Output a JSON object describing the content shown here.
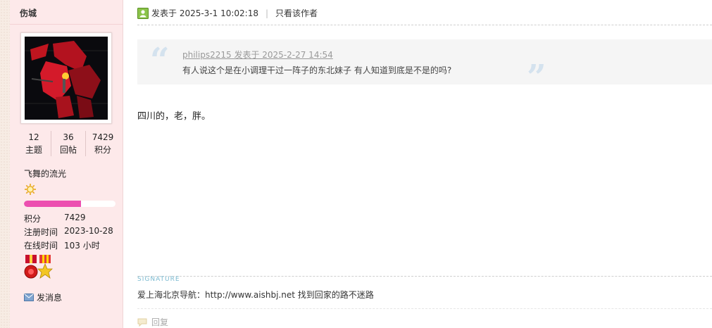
{
  "author": {
    "username": "伤城",
    "stats": [
      {
        "value": "12",
        "label": "主题"
      },
      {
        "value": "36",
        "label": "回帖"
      },
      {
        "value": "7429",
        "label": "积分"
      }
    ],
    "usergroup": "飞舞的流光",
    "level_progress_percent": 62,
    "info": [
      {
        "label": "积分",
        "value": "7429"
      },
      {
        "label": "注册时间",
        "value": "2023-10-28"
      },
      {
        "label": "在线时间",
        "value": "103 小时"
      }
    ],
    "send_message": "发消息",
    "colors": {
      "sidebar_bg": "#fde9ea",
      "progress_fill": "#ec4fb0"
    }
  },
  "post": {
    "posted_at": "发表于 2025-3-1 10:02:18",
    "only_author": "只看该作者",
    "quote": {
      "meta": "philips2215 发表于 2025-2-27 14:54",
      "text": "有人说这个是在小调理干过一阵子的东北妹子 有人知道到底是不是的吗?"
    },
    "body": "四川的，老，胖。",
    "signature_label": "SIGNATURE",
    "signature_text": "爱上海北京导航：http://www.aishbj.net 找到回家的路不迷路",
    "reply_label": "回复"
  }
}
